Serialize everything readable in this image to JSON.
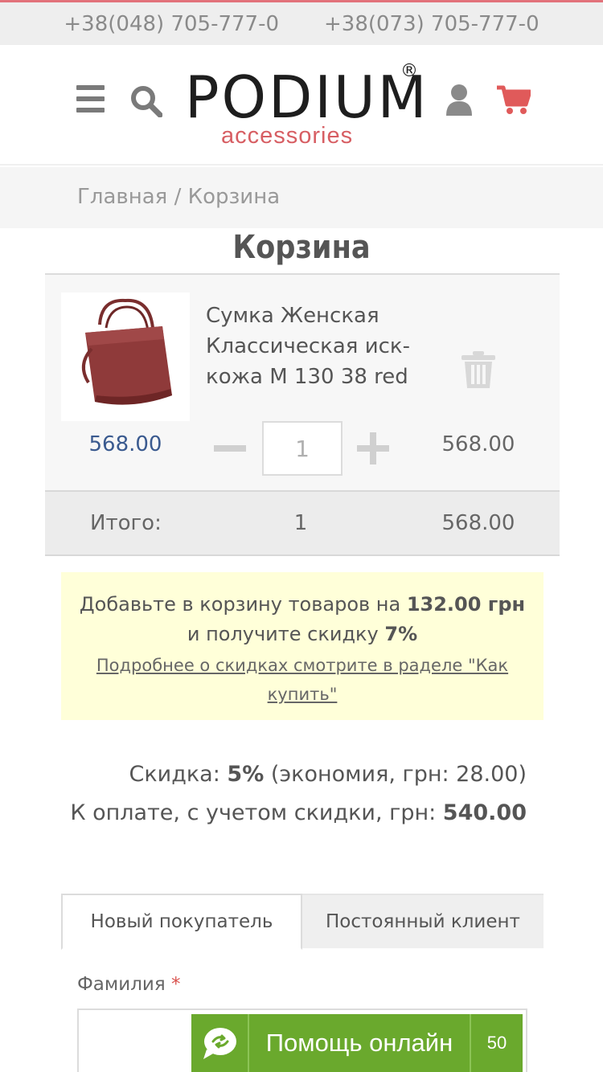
{
  "topbar": {
    "phone1": "+38(048) 705-777-0",
    "phone2": "+38(073) 705-777-0"
  },
  "header": {
    "logo_main": "PODIUM",
    "logo_reg": "®",
    "logo_sub": "accessories",
    "icons": [
      "menu-icon",
      "search-icon",
      "user-icon",
      "cart-icon"
    ],
    "cart_icon_color": "#e05a5a"
  },
  "breadcrumb": {
    "home": "Главная",
    "separator": "/",
    "current": "Корзина"
  },
  "page": {
    "title": "Корзина"
  },
  "cart": {
    "items": [
      {
        "name": "Сумка Женская Классическая иск-кожа М 130 38 red",
        "unit_price": "568.00",
        "quantity": "1",
        "line_total": "568.00"
      }
    ],
    "totals": {
      "label": "Итого:",
      "count": "1",
      "sum": "568.00"
    }
  },
  "promo": {
    "text_before": "Добавьте в корзину товаров на ",
    "amount": "132.00 грн",
    "text_middle": "и получите скидку ",
    "discount": "7%",
    "link": "Подробнее о скидках смотрите в раделе \"Как купить\""
  },
  "discount": {
    "label": "Скидка: ",
    "percent": "5%",
    "saving": " (экономия, грн: 28.00)",
    "pay_label": "К оплате, с учетом скидки, грн: ",
    "pay_amount": "540.00"
  },
  "tabs": [
    {
      "label": "Новый покупатель",
      "active": true
    },
    {
      "label": "Постоянный клиент",
      "active": false
    }
  ],
  "form": {
    "surname_label": "Фамилия",
    "required_mark": "*",
    "surname_value": ""
  },
  "chat": {
    "label": "Помощь онлайн",
    "count": "50",
    "color": "#6aa92d"
  }
}
